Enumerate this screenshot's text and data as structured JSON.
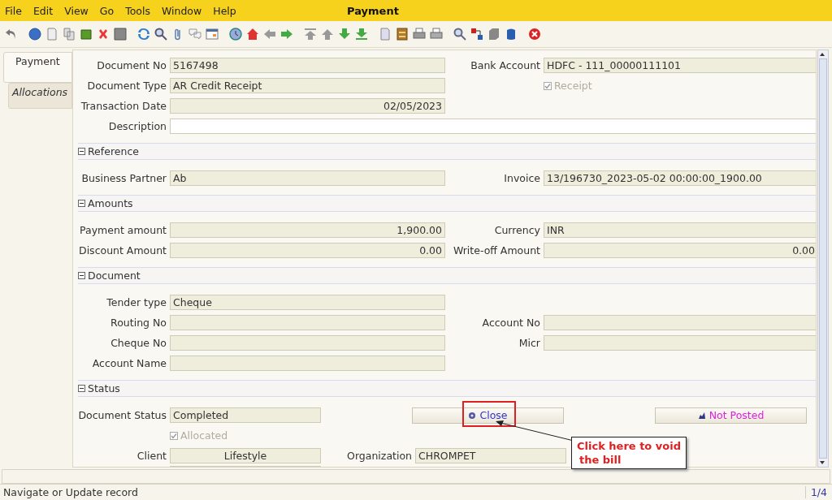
{
  "menu": [
    "File",
    "Edit",
    "View",
    "Go",
    "Tools",
    "Window",
    "Help"
  ],
  "window": {
    "title": "Payment"
  },
  "tabs": [
    {
      "label": "Payment",
      "selected": true
    },
    {
      "label": "Allocations",
      "selected": false
    }
  ],
  "form": [
    {
      "kind": "fields",
      "left": {
        "kind": "field",
        "label": "Document No",
        "value": "5167498",
        "readonly": true
      },
      "right": {
        "kind": "field",
        "label": "Bank Account",
        "value": "HDFC - 111_00000111101",
        "readonly": true
      }
    },
    {
      "kind": "fields",
      "left": {
        "kind": "field",
        "label": "Document Type",
        "value": "AR Credit Receipt",
        "readonly": true
      },
      "right": {
        "kind": "checkbox",
        "label": "Receipt",
        "checked": true,
        "disabled": true
      }
    },
    {
      "kind": "fields",
      "left": {
        "kind": "field",
        "label": "Transaction Date",
        "value": "02/05/2023",
        "readonly": true,
        "numeric": true
      }
    },
    {
      "kind": "wide",
      "label": "Description",
      "readonly": false
    },
    {
      "kind": "section",
      "title": "Reference",
      "expanded": true
    },
    {
      "kind": "fields",
      "left": {
        "kind": "field",
        "label": "Business Partner",
        "value": "Ab",
        "readonly": true
      },
      "right": {
        "kind": "field",
        "label": "Invoice",
        "value": "13/196730_2023-05-02 00:00:00_1900.00",
        "readonly": true
      }
    },
    {
      "kind": "section",
      "title": "Amounts",
      "expanded": true
    },
    {
      "kind": "fields",
      "left": {
        "kind": "field",
        "label": "Payment amount",
        "value": "1,900.00",
        "readonly": true,
        "numeric": true
      },
      "right": {
        "kind": "field",
        "label": "Currency",
        "value": "INR",
        "readonly": true
      }
    },
    {
      "kind": "fields",
      "left": {
        "kind": "field",
        "label": "Discount Amount",
        "value": "0.00",
        "readonly": true,
        "numeric": true
      },
      "right": {
        "kind": "field",
        "label": "Write-off Amount",
        "value": "0.00",
        "readonly": true,
        "numeric": true
      }
    },
    {
      "kind": "section",
      "title": "Document",
      "expanded": true
    },
    {
      "kind": "fields",
      "left": {
        "kind": "field",
        "label": "Tender type",
        "value": "Cheque",
        "readonly": true
      }
    },
    {
      "kind": "fields",
      "left": {
        "kind": "field",
        "label": "Routing No",
        "readonly": true
      },
      "right": {
        "kind": "field",
        "label": "Account No",
        "readonly": true
      }
    },
    {
      "kind": "fields",
      "left": {
        "kind": "field",
        "label": "Cheque No",
        "readonly": true
      },
      "right": {
        "kind": "field",
        "label": "Micr",
        "readonly": true
      }
    },
    {
      "kind": "fields",
      "left": {
        "kind": "field",
        "label": "Account Name",
        "readonly": true
      }
    },
    {
      "kind": "section",
      "title": "Status",
      "expanded": true
    },
    {
      "kind": "status",
      "label": "Document Status",
      "value": "Completed",
      "buttons": [
        {
          "label": "Close",
          "kind": "process",
          "color": "#3333cc"
        },
        {
          "label": "Not Posted",
          "kind": "posting",
          "color": "#e020e0"
        }
      ]
    },
    {
      "kind": "fields",
      "left": {
        "kind": "checkbox",
        "label": "Allocated",
        "checked": true,
        "disabled": true
      }
    },
    {
      "kind": "split",
      "left": {
        "label": "Client",
        "value": "Lifestyle"
      },
      "right": {
        "label": "Organization",
        "value": "CHROMPET"
      }
    },
    {
      "kind": "stub"
    }
  ],
  "annotation": {
    "lines": [
      "Click here to void",
      "the bill"
    ]
  },
  "status_bar": {
    "message": "Navigate or Update record",
    "record": "1/4"
  }
}
